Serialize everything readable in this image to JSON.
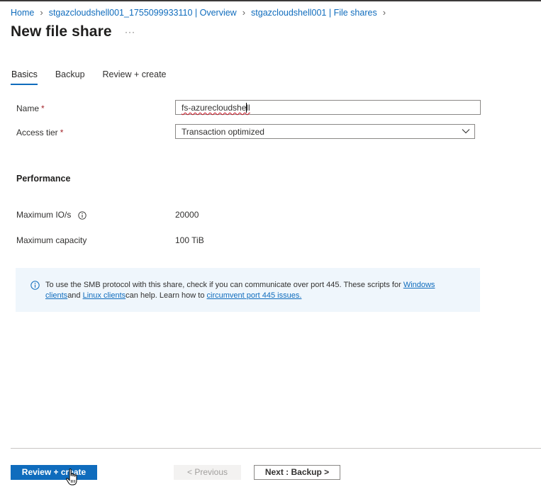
{
  "breadcrumb": {
    "items": [
      "Home",
      "stgazcloudshell001_1755099933110 | Overview",
      "stgazcloudshell001 | File shares"
    ]
  },
  "page": {
    "title": "New file share",
    "more_label": "···"
  },
  "tabs": [
    {
      "label": "Basics",
      "active": true
    },
    {
      "label": "Backup",
      "active": false
    },
    {
      "label": "Review + create",
      "active": false
    }
  ],
  "form": {
    "name_label": "Name",
    "name_value": "fs-azurecloudshell",
    "access_tier_label": "Access tier",
    "access_tier_value": "Transaction optimized",
    "required_marker": "*"
  },
  "performance": {
    "title": "Performance",
    "max_io_label": "Maximum IO/s",
    "max_io_value": "20000",
    "max_capacity_label": "Maximum capacity",
    "max_capacity_value": "100 TiB"
  },
  "info": {
    "text_1": "To use the SMB protocol with this share, check if you can communicate over port 445. These scripts for ",
    "link_windows": "Windows clients",
    "text_2": "and ",
    "link_linux": "Linux clients",
    "text_3": "can help. Learn how to ",
    "link_port": "circumvent port 445 issues."
  },
  "footer": {
    "review_create": "Review + create",
    "previous": "< Previous",
    "next": "Next : Backup >"
  },
  "colors": {
    "accent": "#0f6cbd",
    "info_bg": "#eff6fc",
    "required": "#a4262c"
  }
}
